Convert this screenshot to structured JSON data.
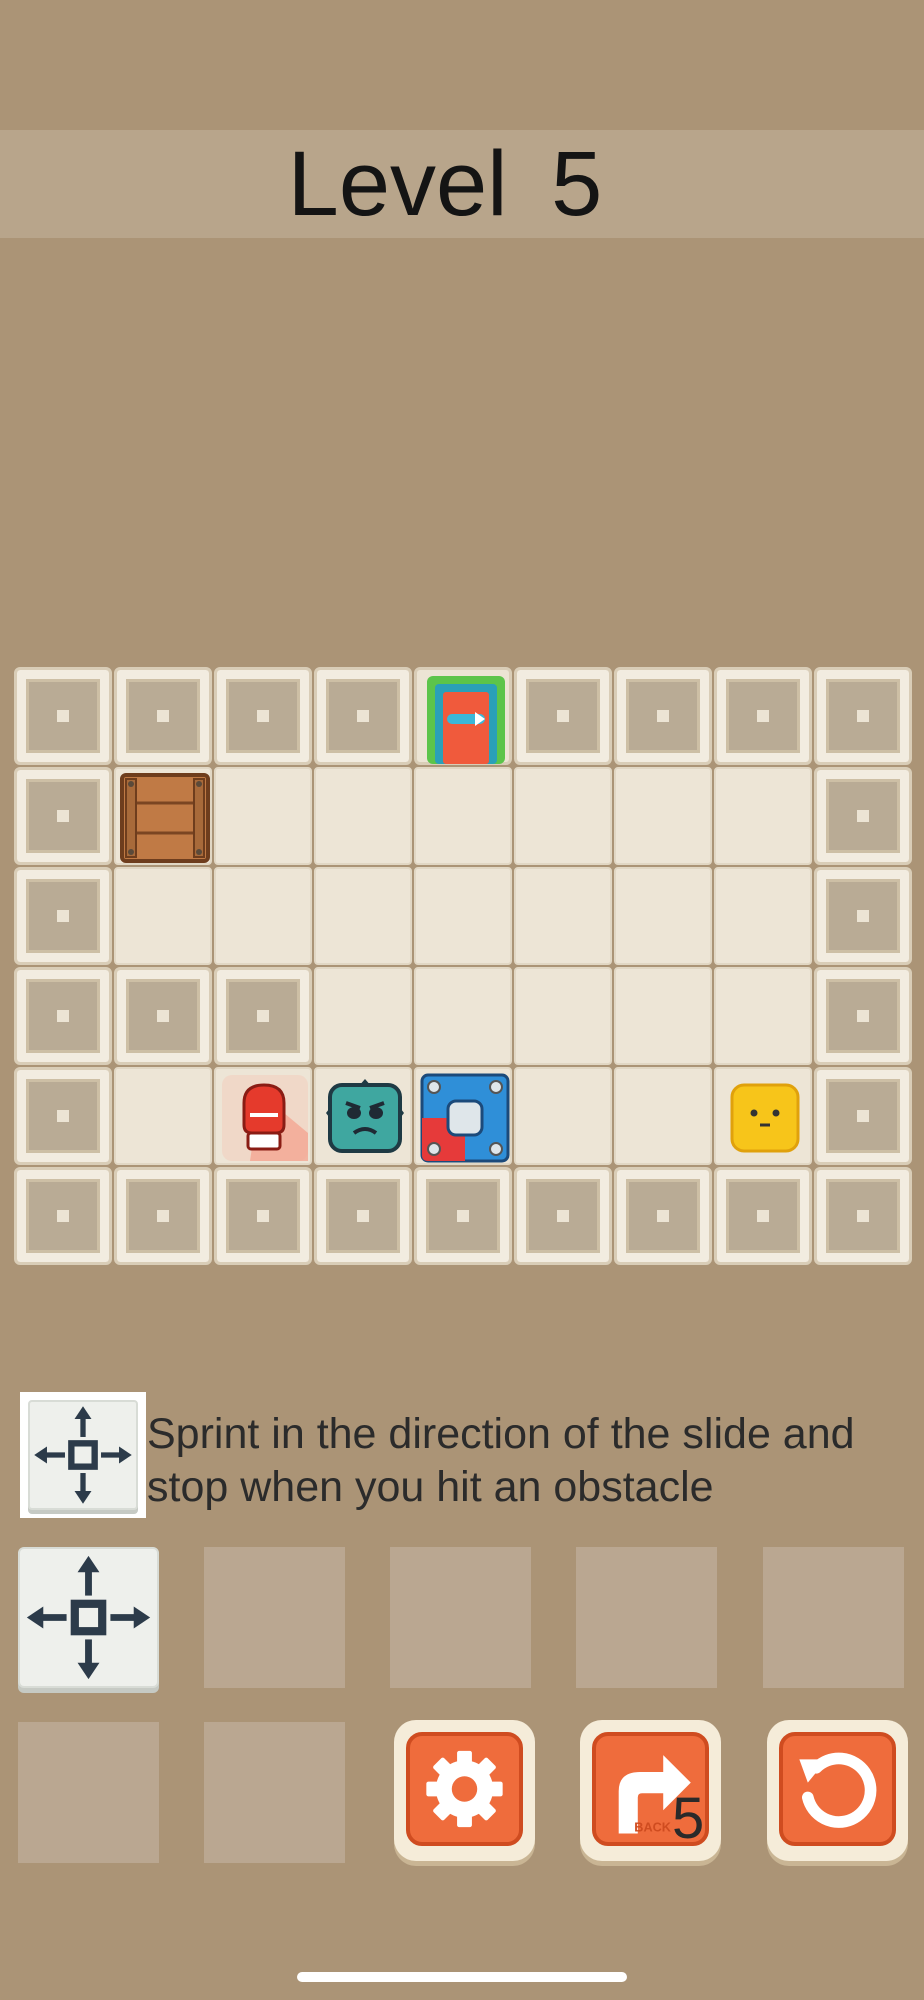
{
  "header": {
    "title": "Level  5"
  },
  "board": {
    "rows": 6,
    "cols": 9,
    "cells": [
      [
        "wall",
        "wall",
        "wall",
        "wall",
        "exit-door",
        "wall",
        "wall",
        "wall",
        "wall"
      ],
      [
        "wall",
        "wooden-crate",
        "floor",
        "floor",
        "floor",
        "floor",
        "floor",
        "floor",
        "wall"
      ],
      [
        "wall",
        "floor",
        "floor",
        "floor",
        "floor",
        "floor",
        "floor",
        "floor",
        "wall"
      ],
      [
        "wall",
        "wall",
        "wall",
        "floor",
        "floor",
        "floor",
        "floor",
        "floor",
        "wall"
      ],
      [
        "wall",
        "floor",
        "boxing-glove",
        "spiky-monster",
        "blue-red-block",
        "floor",
        "floor",
        "yellow-cube-player",
        "wall"
      ],
      [
        "wall",
        "wall",
        "wall",
        "wall",
        "wall",
        "wall",
        "wall",
        "wall",
        "wall"
      ]
    ]
  },
  "hint": {
    "icon": "move-arrows-icon",
    "text_line1": "Sprint in the direction of the slide and",
    "text_line2": "stop when you hit an obstacle"
  },
  "inventory": {
    "slots": [
      "move-arrows-icon",
      "",
      "",
      "",
      "",
      "",
      ""
    ]
  },
  "controls": {
    "settings": {
      "icon": "gear-icon"
    },
    "back": {
      "icon": "back-arrow-icon",
      "label": "BACK",
      "count": "5"
    },
    "restart": {
      "icon": "restart-icon"
    }
  },
  "colors": {
    "background": "#ab9476",
    "title_bar": "#b8a58b",
    "button_orange": "#ef6c3c",
    "player_yellow": "#f7c51a"
  }
}
